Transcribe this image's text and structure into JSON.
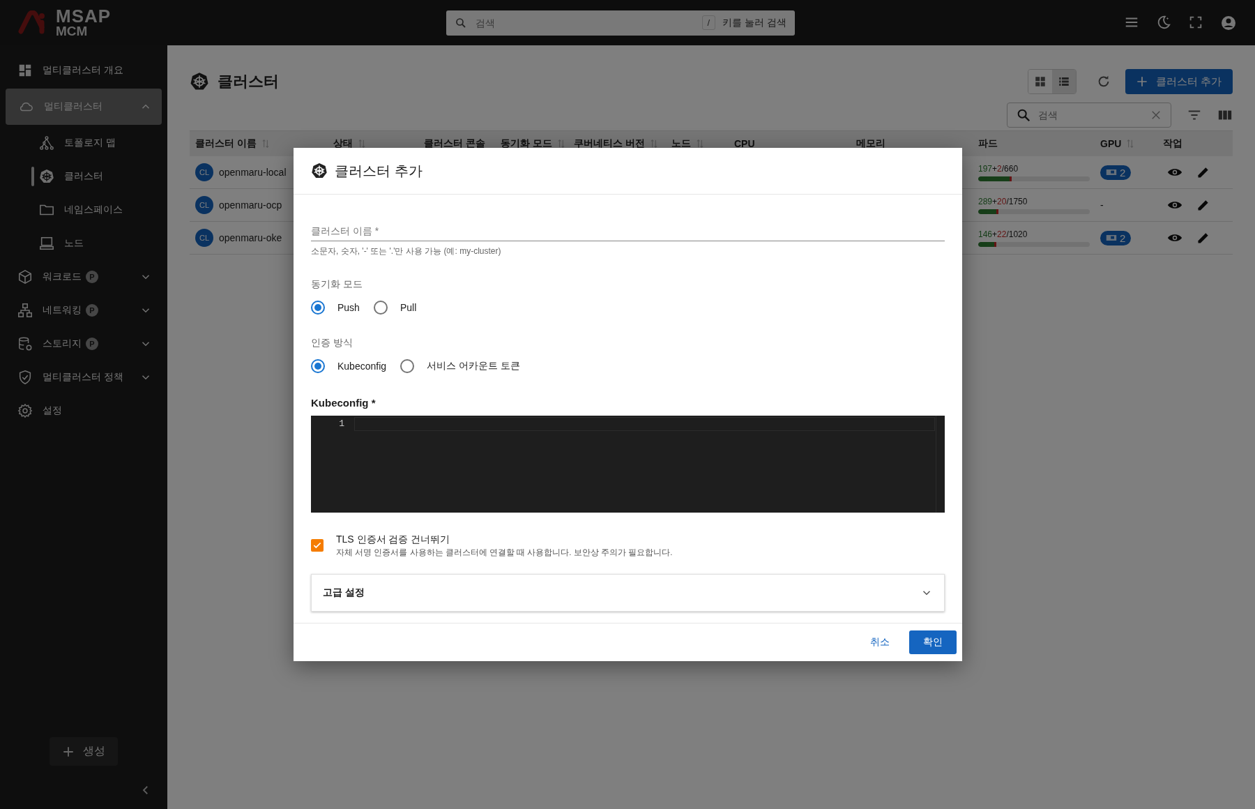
{
  "topbar": {
    "logo": {
      "line_1": "MSAP",
      "line_2": "MCM"
    },
    "search": {
      "placeholder": "검색",
      "shortcut_key": "/",
      "shortcut_hint": "키를 눌러 검색"
    }
  },
  "sidebar": {
    "items": [
      {
        "label": "멀티클러스터 개요",
        "selected": false
      },
      {
        "label": "멀티클러스터",
        "selected": true,
        "expanded": true,
        "children": [
          {
            "label": "토폴로지 맵",
            "selected": false
          },
          {
            "label": "클러스터",
            "selected": true
          },
          {
            "label": "네임스페이스",
            "selected": false
          },
          {
            "label": "노드",
            "selected": false
          }
        ]
      },
      {
        "label": "워크로드",
        "selected": false,
        "badge": "P",
        "expanded": false
      },
      {
        "label": "네트워킹",
        "selected": false,
        "badge": "P",
        "expanded": false
      },
      {
        "label": "스토리지",
        "selected": false,
        "badge": "P",
        "expanded": false
      },
      {
        "label": "멀티클러스터 정책",
        "selected": false,
        "expanded": false
      },
      {
        "label": "설정",
        "selected": false
      }
    ],
    "create_button": "생성"
  },
  "page": {
    "title": "클러스터",
    "view_toggle": [
      {
        "selected": false
      },
      {
        "selected": true
      }
    ],
    "add_button": "클러스터 추가",
    "search": {
      "placeholder": "검색"
    }
  },
  "table": {
    "columns": [
      {
        "label": "클러스터 이름",
        "sortable": true
      },
      {
        "label": "상태",
        "sortable": true
      },
      {
        "label": "클러스터 콘솔",
        "sortable": false
      },
      {
        "label": "동기화 모드",
        "sortable": true
      },
      {
        "label": "쿠버네티스 버전",
        "sortable": true
      },
      {
        "label": "노드",
        "sortable": true
      },
      {
        "label": "CPU",
        "sortable": false
      },
      {
        "label": "메모리",
        "sortable": false
      },
      {
        "label": "파드",
        "sortable": false
      },
      {
        "label": "GPU",
        "sortable": true
      },
      {
        "label": "작업",
        "sortable": false
      }
    ],
    "rows": [
      {
        "avatar": "CL",
        "name": "openmaru-local",
        "pods": {
          "running": "197",
          "separator": "+",
          "pending": "2",
          "total": "/660",
          "level": 0.3
        },
        "gpu": {
          "kind": "badge",
          "text": "2"
        }
      },
      {
        "avatar": "CL",
        "name": "openmaru-ocp",
        "pods": {
          "running": "289",
          "separator": "+",
          "pending": "20",
          "total": "/1750",
          "level": 0.18
        },
        "gpu": {
          "kind": "text",
          "text": "-"
        }
      },
      {
        "avatar": "CL",
        "name": "openmaru-oke",
        "pods": {
          "running": "146",
          "separator": "+",
          "pending": "22",
          "total": "/1020",
          "level": 0.16
        },
        "gpu": {
          "kind": "badge",
          "text": "2"
        }
      }
    ]
  },
  "dialog": {
    "title": "클러스터 추가",
    "name_field": {
      "placeholder": "클러스터 이름 *",
      "helper": "소문자, 숫자, '-' 또는 '.'만 사용 가능 (예: my-cluster)"
    },
    "sync_mode": {
      "label": "동기화 모드",
      "options": [
        {
          "label": "Push",
          "selected": true
        },
        {
          "label": "Pull",
          "selected": false
        }
      ]
    },
    "auth_method": {
      "label": "인증 방식",
      "options": [
        {
          "label": "Kubeconfig",
          "selected": true
        },
        {
          "label": "서비스 어카운트 토큰",
          "selected": false
        }
      ]
    },
    "kubeconfig": {
      "label": "Kubeconfig *",
      "line_numbers": [
        "1"
      ]
    },
    "tls_skip": {
      "label": "TLS 인증서 검증 건너뛰기",
      "description": "자체 서명 인증서를 사용하는 클러스터에 연결할 때 사용합니다. 보안상 주의가 필요합니다.",
      "checked": true
    },
    "advanced": {
      "label": "고급 설정",
      "expanded": false
    },
    "buttons": {
      "cancel": "취소",
      "confirm": "확인"
    }
  }
}
